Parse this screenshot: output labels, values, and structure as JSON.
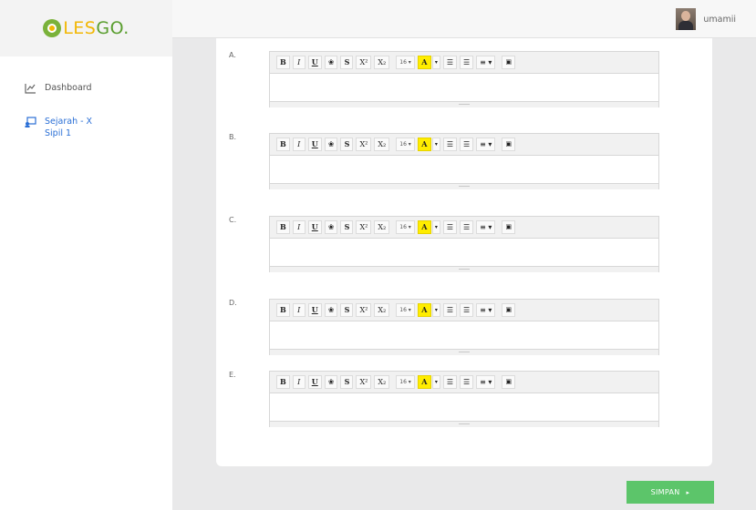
{
  "brand": {
    "logo_text_1": "LES",
    "logo_text_2": "GO."
  },
  "sidebar": {
    "items": [
      {
        "label": "Dashboard",
        "icon": "chart-icon"
      },
      {
        "label": "Sejarah - X Sipil 1",
        "icon": "class-icon"
      }
    ]
  },
  "topbar": {
    "username": "umamii"
  },
  "toolbar": {
    "bold": "B",
    "italic": "I",
    "underline": "U",
    "eraser": "❀",
    "strikethrough": "S",
    "superscript": "X²",
    "subscript": "X₂",
    "font_size": "16 ▾",
    "font_color": "A",
    "color_caret": "▾",
    "unordered_list": "☰",
    "ordered_list": "☰",
    "align": "≡ ▾",
    "image": "▣"
  },
  "options": [
    {
      "label": "A."
    },
    {
      "label": "B."
    },
    {
      "label": "C."
    },
    {
      "label": "D."
    },
    {
      "label": "E."
    }
  ],
  "submit": {
    "label": "SIMPAN",
    "arrow": "▸"
  },
  "colors": {
    "accent": "#5cc56a",
    "active_nav": "#2a6fd6",
    "brand_yellow": "#f2b705",
    "brand_green": "#5a9e2f"
  }
}
